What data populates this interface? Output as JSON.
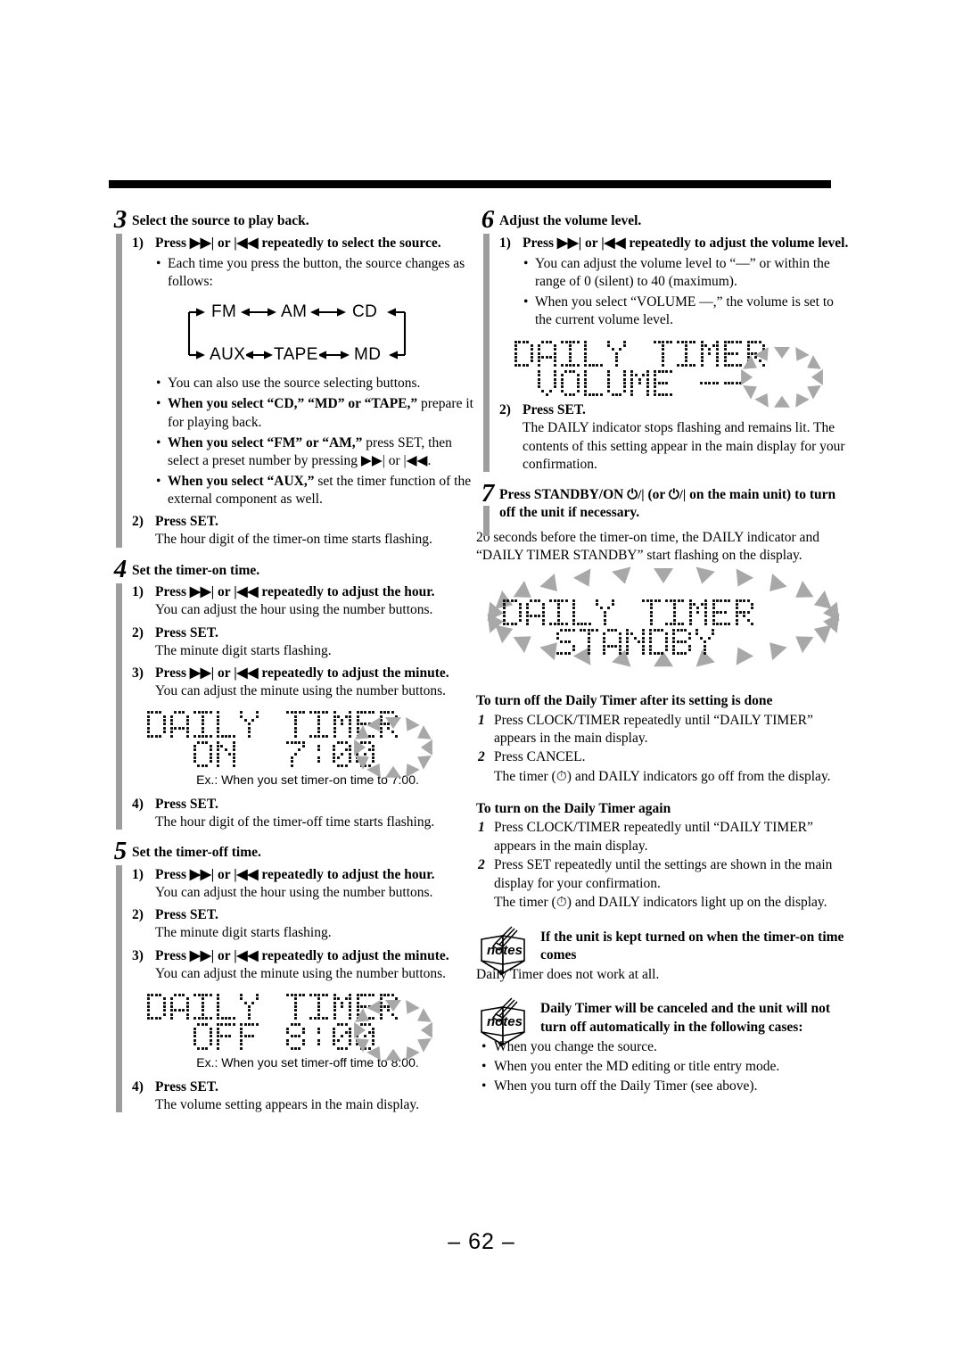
{
  "page": {
    "number": "– 62 –"
  },
  "left_column": {
    "steps": [
      {
        "num": "3",
        "title": "Select the source to play back.",
        "sub1_marker": "1)",
        "sub1_head": "Press ▶▶| or |◀◀ repeatedly to select the source.",
        "sub1_bullet": "Each time you press the button, the source changes as follows:",
        "flow": {
          "row1": [
            "FM",
            "AM",
            "CD"
          ],
          "row2": [
            "AUX",
            "TAPE",
            "MD"
          ]
        },
        "bullets": [
          {
            "bold": "",
            "text": "You can also use the source selecting buttons."
          },
          {
            "bold": "When you select “CD,” “MD” or “TAPE,”",
            "text": " prepare it for playing back."
          },
          {
            "bold": "When you select “FM” or “AM,”",
            "text": " press SET, then select a preset number by pressing ▶▶| or |◀◀."
          },
          {
            "bold": "When you select “AUX,”",
            "text": " set the timer function of the external component as well."
          }
        ],
        "sub2_marker": "2)",
        "sub2_head": "Press SET.",
        "sub2_body": "The hour digit of the timer-on time starts flashing."
      },
      {
        "num": "4",
        "title": "Set the timer-on time.",
        "items": [
          {
            "marker": "1)",
            "head": "Press ▶▶| or |◀◀ repeatedly to adjust the hour.",
            "body": "You can adjust the hour using the number buttons."
          },
          {
            "marker": "2)",
            "head": "Press SET.",
            "body": "The minute digit starts flashing."
          },
          {
            "marker": "3)",
            "head": "Press ▶▶| or |◀◀ repeatedly to adjust the minute.",
            "body": "You can adjust the minute using the number buttons."
          }
        ],
        "lcd": {
          "line1": "DAILY TIMER",
          "line2": "ON  7:00",
          "flashing": "00"
        },
        "caption": "Ex.: When you set timer-on time to 7:00.",
        "after": {
          "marker": "4)",
          "head": "Press SET.",
          "body": "The hour digit of the timer-off time starts flashing."
        }
      },
      {
        "num": "5",
        "title": "Set the timer-off time.",
        "items": [
          {
            "marker": "1)",
            "head": "Press ▶▶| or |◀◀ repeatedly to adjust the hour.",
            "body": "You can adjust the hour using the number buttons."
          },
          {
            "marker": "2)",
            "head": "Press SET.",
            "body": "The minute digit starts flashing."
          },
          {
            "marker": "3)",
            "head": "Press ▶▶| or |◀◀ repeatedly to adjust the minute.",
            "body": "You can adjust the minute using the number buttons."
          }
        ],
        "lcd": {
          "line1": "DAILY TIMER",
          "line2": "OFF 8:00",
          "flashing": "00"
        },
        "caption": "Ex.: When you set timer-off time to 8:00.",
        "after": {
          "marker": "4)",
          "head": "Press SET.",
          "body": "The volume setting appears in the main display."
        }
      }
    ]
  },
  "right_column": {
    "step6": {
      "num": "6",
      "title": "Adjust the volume level.",
      "sub1_marker": "1)",
      "sub1_head": "Press ▶▶| or |◀◀ repeatedly to adjust the volume level.",
      "bullets": [
        "You can adjust the volume level to “––” or within the range of 0 (silent) to 40 (maximum).",
        "When you select “VOLUME ––,” the volume is set to the current volume level."
      ],
      "lcd": {
        "line1": "DAILY TIMER",
        "line2": "VOLUME --",
        "flashing": "--"
      },
      "sub2_marker": "2)",
      "sub2_head": "Press SET.",
      "sub2_body": "The DAILY indicator stops flashing and remains lit. The contents of this setting appear in the main display for your confirmation."
    },
    "step7": {
      "num": "7",
      "title_a": "Press STANDBY/ON",
      "title_b": "(or",
      "title_c": "on the main unit)",
      "title_d": "to turn off the unit if necessary.",
      "power_symbol": "⏻/|",
      "body": "20 seconds before the timer-on time, the DAILY indicator and “DAILY TIMER STANDBY” start flashing on the display.",
      "lcd": {
        "line1": "DAILY TIMER",
        "line2": "STANDBY"
      }
    },
    "turn_off": {
      "heading": "To turn off the Daily Timer after its setting is done",
      "items": [
        {
          "n": "1",
          "text": "Press CLOCK/TIMER repeatedly until “DAILY TIMER” appears in the main display."
        },
        {
          "n": "2",
          "text": "Press CANCEL."
        }
      ],
      "trailing": "The timer (⏱) and DAILY indicators go off from the display."
    },
    "turn_on": {
      "heading": "To turn on the Daily Timer again",
      "items": [
        {
          "n": "1",
          "text": "Press CLOCK/TIMER repeatedly until “DAILY TIMER” appears in the main display."
        },
        {
          "n": "2",
          "text": "Press SET repeatedly until the settings are shown in the main display for your confirmation."
        }
      ],
      "trailing": "The timer (⏱) and DAILY indicators light up on the display."
    },
    "notes": [
      {
        "label": "notes",
        "bold": "If the unit is kept turned on when the timer-on time comes",
        "body": "Daily Timer does not work at all.",
        "bullets": []
      },
      {
        "label": "notes",
        "bold": "Daily Timer will be canceled and the unit will not turn off automatically in the following cases:",
        "body": "",
        "bullets": [
          "When you change the source.",
          "When you enter the MD editing or title entry mode.",
          "When you turn off the Daily Timer (see above)."
        ]
      }
    ]
  }
}
